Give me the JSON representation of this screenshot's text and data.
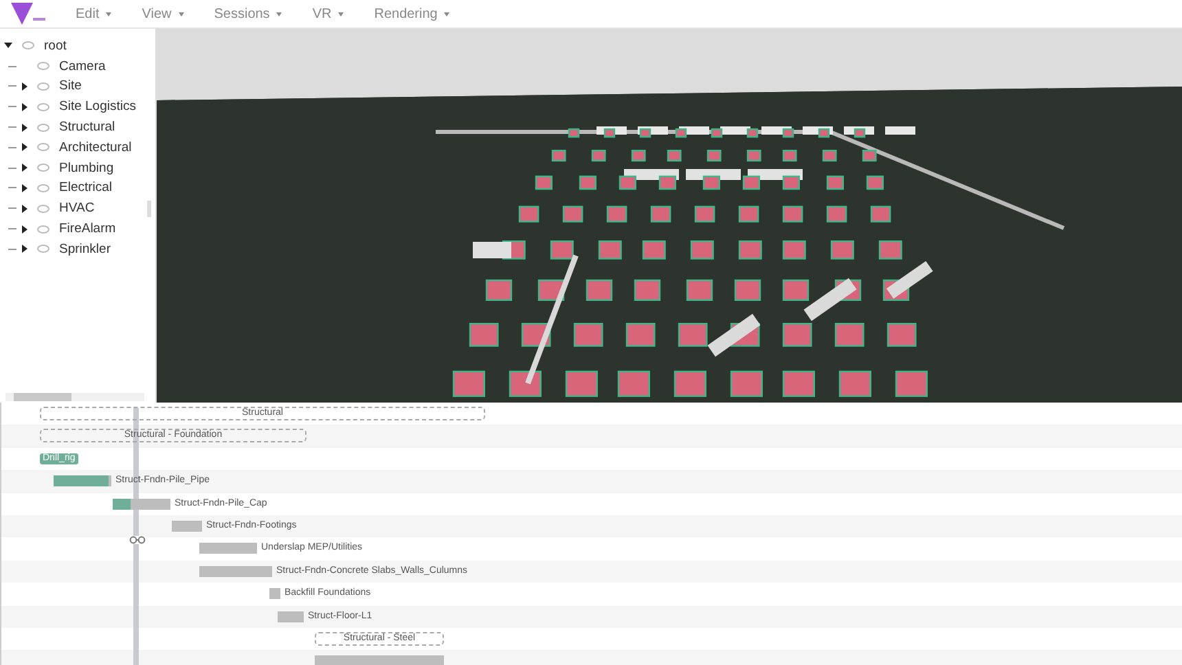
{
  "menu": [
    {
      "label": "Edit"
    },
    {
      "label": "View"
    },
    {
      "label": "Sessions"
    },
    {
      "label": "VR"
    },
    {
      "label": "Rendering"
    }
  ],
  "tree": {
    "label": "root",
    "expanded": true,
    "children": [
      {
        "label": "Camera",
        "expandable": false
      },
      {
        "label": "Site",
        "expandable": true
      },
      {
        "label": "Site Logistics",
        "expandable": true
      },
      {
        "label": "Structural",
        "expandable": true
      },
      {
        "label": "Architectural",
        "expandable": true
      },
      {
        "label": "Plumbing",
        "expandable": true
      },
      {
        "label": "Electrical",
        "expandable": true
      },
      {
        "label": "HVAC",
        "expandable": true
      },
      {
        "label": "FireAlarm",
        "expandable": true
      },
      {
        "label": "Sprinkler",
        "expandable": true
      }
    ]
  },
  "schedule": [
    {
      "kind": "group",
      "label": "Structural"
    },
    {
      "kind": "group",
      "label": "Structural - Foundation"
    },
    {
      "kind": "inline",
      "label": "Drill_rig",
      "level": 1
    },
    {
      "kind": "task",
      "label": "Struct-Fndn-Pile_Pipe",
      "level": 0.95
    },
    {
      "kind": "task",
      "label": "Struct-Fndn-Pile_Cap",
      "level": 0.3
    },
    {
      "kind": "task",
      "label": "Struct-Fndn-Footings"
    },
    {
      "kind": "task",
      "label": "Underslap MEP/Utilities"
    },
    {
      "kind": "task",
      "label": "Struct-Fndn-Concrete Slabs_Walls_Culumns"
    },
    {
      "kind": "task",
      "label": "Backfill Foundations"
    },
    {
      "kind": "task",
      "label": "Struct-Floor-L1"
    },
    {
      "kind": "group",
      "label": "Structural - Steel"
    },
    {
      "kind": "task"
    }
  ]
}
